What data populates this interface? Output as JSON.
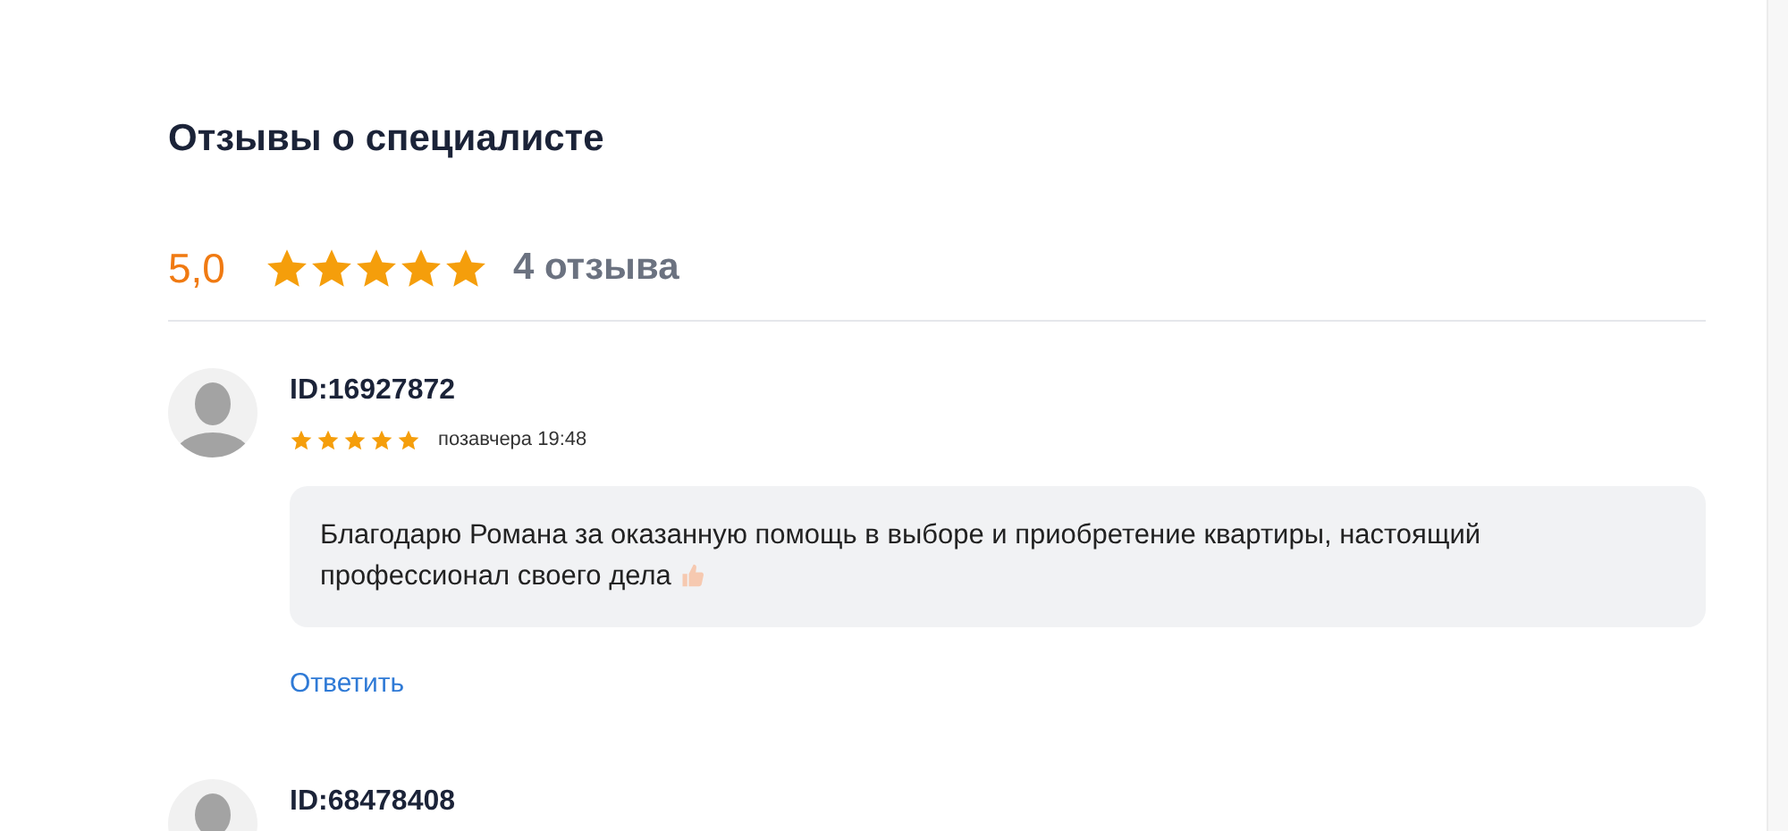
{
  "title": "Отзывы о специалисте",
  "summary": {
    "score": "5,0",
    "stars": 5,
    "count": "4 отзыва"
  },
  "reviews": [
    {
      "author": "ID:16927872",
      "stars": 5,
      "time": "позавчера 19:48",
      "text": "Благодарю Романа за оказанную помощь в выборе и приобретение квартиры, настоящий профессионал своего дела",
      "reply": "Ответить"
    },
    {
      "author": "ID:68478408"
    }
  ]
}
